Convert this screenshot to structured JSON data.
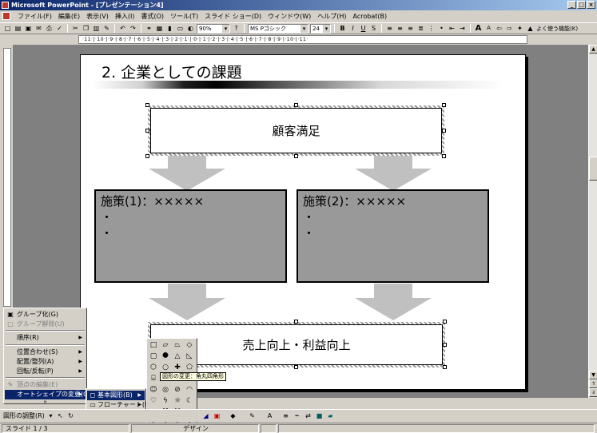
{
  "window": {
    "title": "Microsoft PowerPoint - [プレゼンテーション4]",
    "min": "_",
    "max": "□",
    "close": "×"
  },
  "menu": [
    "ファイル(F)",
    "編集(E)",
    "表示(V)",
    "挿入(I)",
    "書式(O)",
    "ツール(T)",
    "スライド ショー(D)",
    "ウィンドウ(W)",
    "ヘルプ(H)",
    "Acrobat(B)"
  ],
  "toolbar": {
    "zoom": "90%",
    "font": "MS Pゴシック",
    "size": "24",
    "bold": "B",
    "italic": "I",
    "underline": "U",
    "shadow": "S",
    "font_grow": "A",
    "font_shrink": "A",
    "common_tasks": "よく使う機能(K)"
  },
  "ruler": "·11·|·10·|·9·|·8·|·7·|·6·|·5·|·4·|·3·|·2·|·1·|·0·|·1·|·2·|·3·|·4·|·5·|·6·|·7·|·8·|·9·|·10·|·11·",
  "slide": {
    "title": "2. 企業としての課題",
    "customer_box": "顧客満足",
    "measure1_title": "施策(1)：×××××",
    "measure2_title": "施策(2)：×××××",
    "bullet": "・",
    "sales_box": "売上向上・利益向上"
  },
  "context_menu": {
    "group": "グループ化(G)",
    "ungroup": "グループ解除(U)",
    "order": "順序(R)",
    "align": "位置合わせ(S)",
    "distribute": "配置/整列(A)",
    "rotate": "回転/反転(P)",
    "edit_points": "頂点の編集(E)",
    "change_autoshape": "オートシェイプの変更(C)",
    "more": "»"
  },
  "submenu": {
    "basic_shapes": "基本図形(B)",
    "flowchart": "フローチャート(F)",
    "more": "»"
  },
  "tooltip": "図形の変更：角丸四角形",
  "drawbar": {
    "draw_menu": "図形の調整(R)"
  },
  "status": {
    "slide": "スライド 1 / 3",
    "design": "デザイン"
  },
  "colors": {
    "title_bar_start": "#0a246a",
    "title_bar_end": "#a6caf0",
    "gray_box": "#999999",
    "arrow": "#c0c0c0",
    "workspace": "#808080"
  }
}
